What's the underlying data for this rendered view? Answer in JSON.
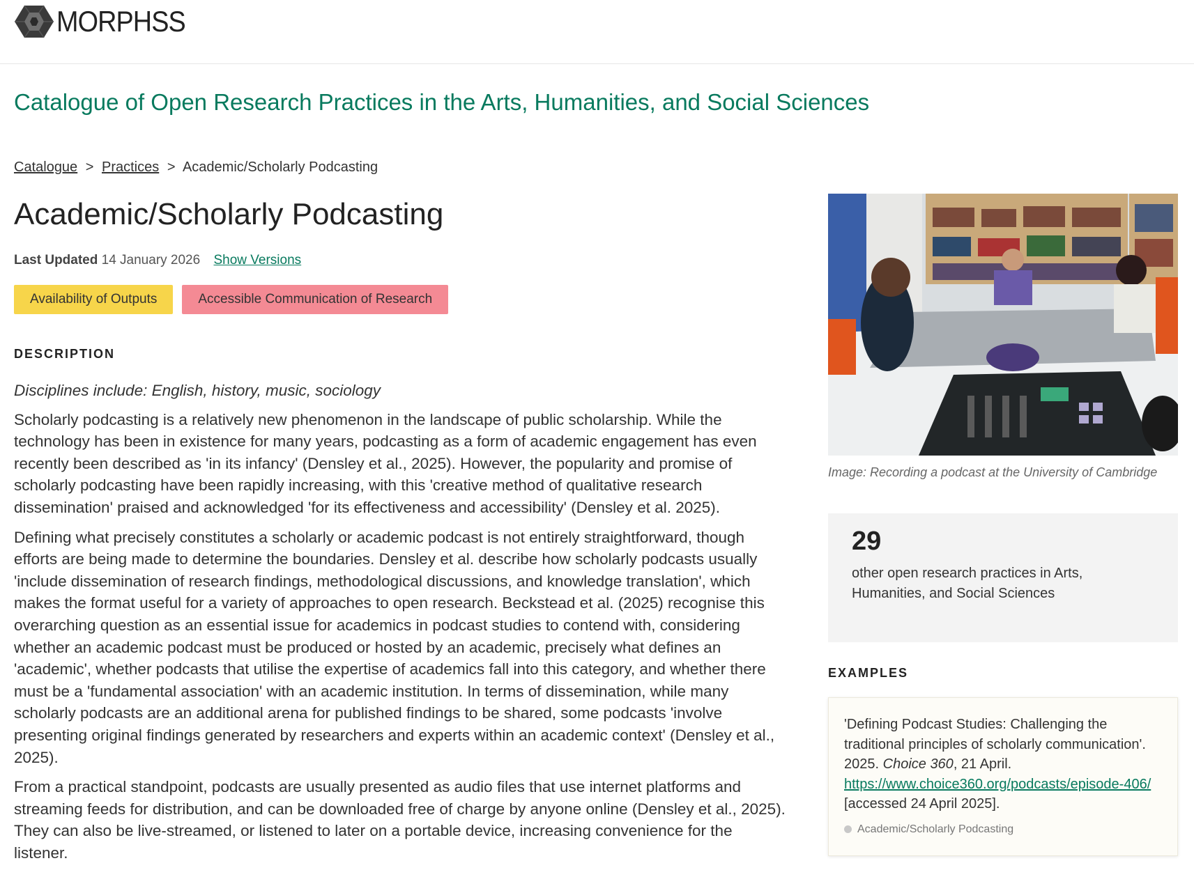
{
  "brand": {
    "name": "MORPHSS"
  },
  "site_title": "Catalogue of Open Research Practices in the Arts, Humanities, and Social Sciences",
  "breadcrumb": {
    "items": [
      "Catalogue",
      "Practices",
      "Academic/Scholarly Podcasting"
    ],
    "separator": ">"
  },
  "page_title": "Academic/Scholarly Podcasting",
  "meta": {
    "last_updated_label": "Last Updated",
    "last_updated_value": "14 January 2026",
    "show_versions": "Show Versions"
  },
  "tags": [
    {
      "label": "Availability of Outputs",
      "color": "#f7d54a"
    },
    {
      "label": "Accessible Communication of Research",
      "color": "#f48a94"
    }
  ],
  "description": {
    "heading": "DESCRIPTION",
    "disciplines": "Disciplines include: English, history, music, sociology",
    "paragraphs": [
      "Scholarly podcasting is a relatively new phenomenon in the landscape of public scholarship. While the technology has been in existence for many years, podcasting as a form of academic engagement has even recently been described as 'in its infancy' (Densley et al., 2025). However, the popularity and promise of scholarly podcasting have been rapidly increasing, with this 'creative method of qualitative research dissemination' praised and acknowledged 'for its effectiveness and accessibility' (Densley et al. 2025).",
      "Defining what precisely constitutes a scholarly or academic podcast is not entirely straightforward, though efforts are being made to determine the boundaries. Densley et al. describe how scholarly podcasts usually 'include dissemination of research findings, methodological discussions, and knowledge translation', which makes the format useful for a variety of approaches to open research. Beckstead et al. (2025) recognise this overarching question as an essential issue for academics in podcast studies to contend with, considering whether an academic podcast must be produced or hosted by an academic, precisely what defines an 'academic', whether podcasts that utilise the expertise of academics fall into this category, and whether there must be a 'fundamental association' with an academic institution. In terms of dissemination, while many scholarly podcasts are an additional arena for published findings to be shared, some podcasts 'involve presenting original findings generated by researchers and experts within an academic context' (Densley et al., 2025).",
      "From a practical standpoint, podcasts are usually presented as audio files that use internet platforms and streaming feeds for distribution, and can be downloaded free of charge by anyone online (Densley et al., 2025). They can also be live-streamed, or listened to later on a portable device, increasing convenience for the listener."
    ]
  },
  "image": {
    "caption": "Image: Recording a podcast at the University of Cambridge"
  },
  "stats": {
    "number": "29",
    "text": "other open research practices in Arts, Humanities, and Social Sciences"
  },
  "examples": {
    "heading": "EXAMPLES",
    "items": [
      {
        "title": "'Defining Podcast Studies: Challenging the traditional principles of scholarly communication'.",
        "year": "2025.",
        "source": "Choice 360",
        "date": ", 21 April.",
        "url": "https://www.choice360.org/podcasts/episode-406/",
        "accessed": "[accessed 24 April 2025].",
        "tag": "Academic/Scholarly Podcasting"
      }
    ]
  },
  "colors": {
    "accent": "#087a5e",
    "tag_yellow": "#f7d54a",
    "tag_pink": "#f48a94"
  }
}
